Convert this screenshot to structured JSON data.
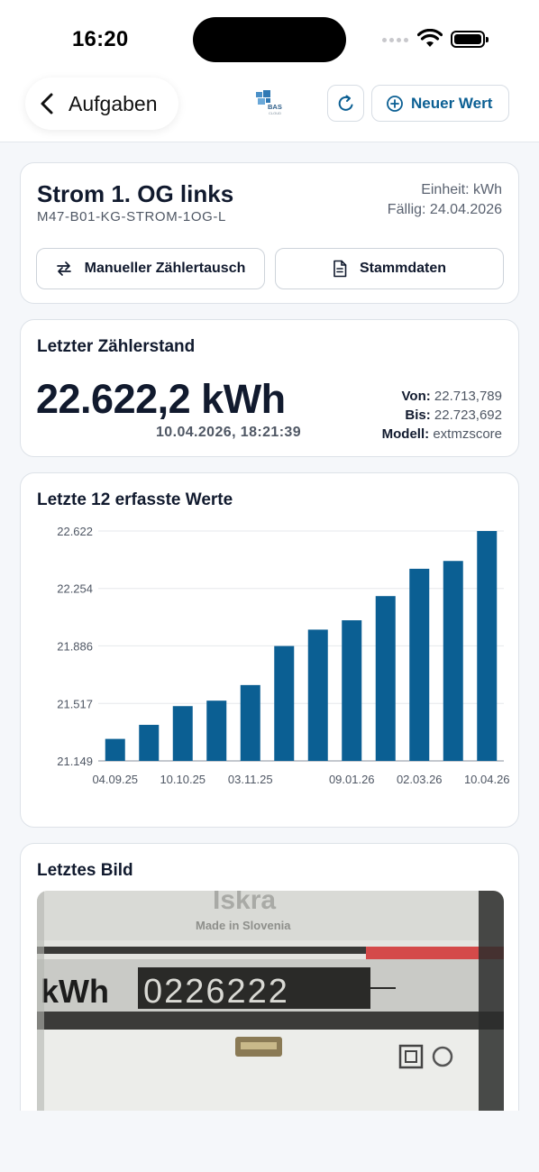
{
  "status_bar": {
    "time": "16:20"
  },
  "nav": {
    "back_label": "Aufgaben",
    "logo_text": "BAS",
    "logo_subtext": "CLOUD",
    "new_value_label": "Neuer Wert"
  },
  "meter": {
    "name": "Strom 1. OG links",
    "id": "M47-B01-KG-STROM-1OG-L",
    "unit": "Einheit: kWh",
    "due": "Fällig: 24.04.2026",
    "btn_swap": "Manueller Zählertausch",
    "btn_master": "Stammdaten"
  },
  "last_reading": {
    "title": "Letzter Zählerstand",
    "value": "22.622,2 kWh",
    "timestamp": "10.04.2026, 18:21:39",
    "von_label": "Von:",
    "von_value": "22.713,789",
    "bis_label": "Bis:",
    "bis_value": "22.723,692",
    "modell_label": "Modell:",
    "modell_value": "extmzscore"
  },
  "chart_section": {
    "title": "Letzte 12 erfasste Werte"
  },
  "chart_data": {
    "type": "bar",
    "title": "Letzte 12 erfasste Werte",
    "categories": [
      "04.09.25",
      "",
      "10.10.25",
      "",
      "03.11.25",
      "",
      "",
      "09.01.26",
      "",
      "02.03.26",
      "",
      "10.04.26"
    ],
    "values": [
      21.29,
      21.38,
      21.5,
      21.535,
      21.635,
      21.885,
      21.99,
      22.05,
      22.205,
      22.38,
      22.43,
      22.622
    ],
    "yticks": [
      "22.622",
      "22.254",
      "21.886",
      "21.517",
      "21.149"
    ],
    "ylim": [
      21.149,
      22.622
    ],
    "grid": true,
    "bar_color": "#0b5f93"
  },
  "last_image": {
    "title": "Letztes Bild",
    "brand": "Iskra",
    "made_in": "Made in Slovenia",
    "unit": "kWh",
    "digits": "0226222"
  }
}
